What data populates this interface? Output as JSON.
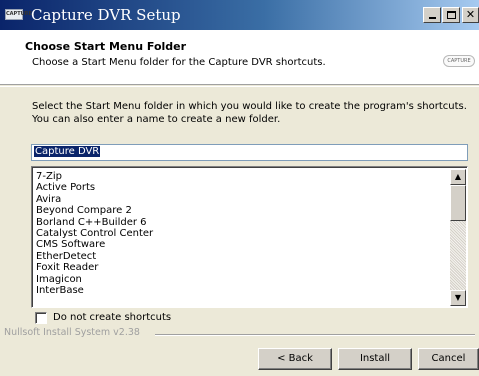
{
  "window": {
    "title": "Capture DVR Setup",
    "icon_text": "CAPTURE"
  },
  "header": {
    "title": "Choose Start Menu Folder",
    "subtitle": "Choose a Start Menu folder for the Capture DVR shortcuts.",
    "logo_text": "CAPTURE"
  },
  "body": {
    "instructions": "Select the Start Menu folder in which you would like to create the program's shortcuts. You can also enter a name to create a new folder.",
    "folder_input_value": "Capture DVR",
    "folder_list": [
      "7-Zip",
      "Active Ports",
      "Avira",
      "Beyond Compare 2",
      "Borland C++Builder 6",
      "Catalyst Control Center",
      "CMS Software",
      "EtherDetect",
      "Foxit Reader",
      "Imagicon",
      "InterBase"
    ],
    "checkbox_label": "Do not create shortcuts",
    "checkbox_checked": false
  },
  "footer": {
    "branding": "Nullsoft Install System v2.38",
    "back_label": "< Back",
    "install_label": "Install",
    "cancel_label": "Cancel"
  },
  "icons": {
    "scroll_up": "scroll-up-icon",
    "scroll_down": "scroll-down-icon",
    "minimize": "minimize-icon",
    "maximize": "maximize-icon",
    "close": "close-icon"
  },
  "colors": {
    "titlebar_start": "#0a246a",
    "titlebar_end": "#a6caf0",
    "selection": "#0a246a",
    "dialog_bg": "#ece9d8"
  }
}
